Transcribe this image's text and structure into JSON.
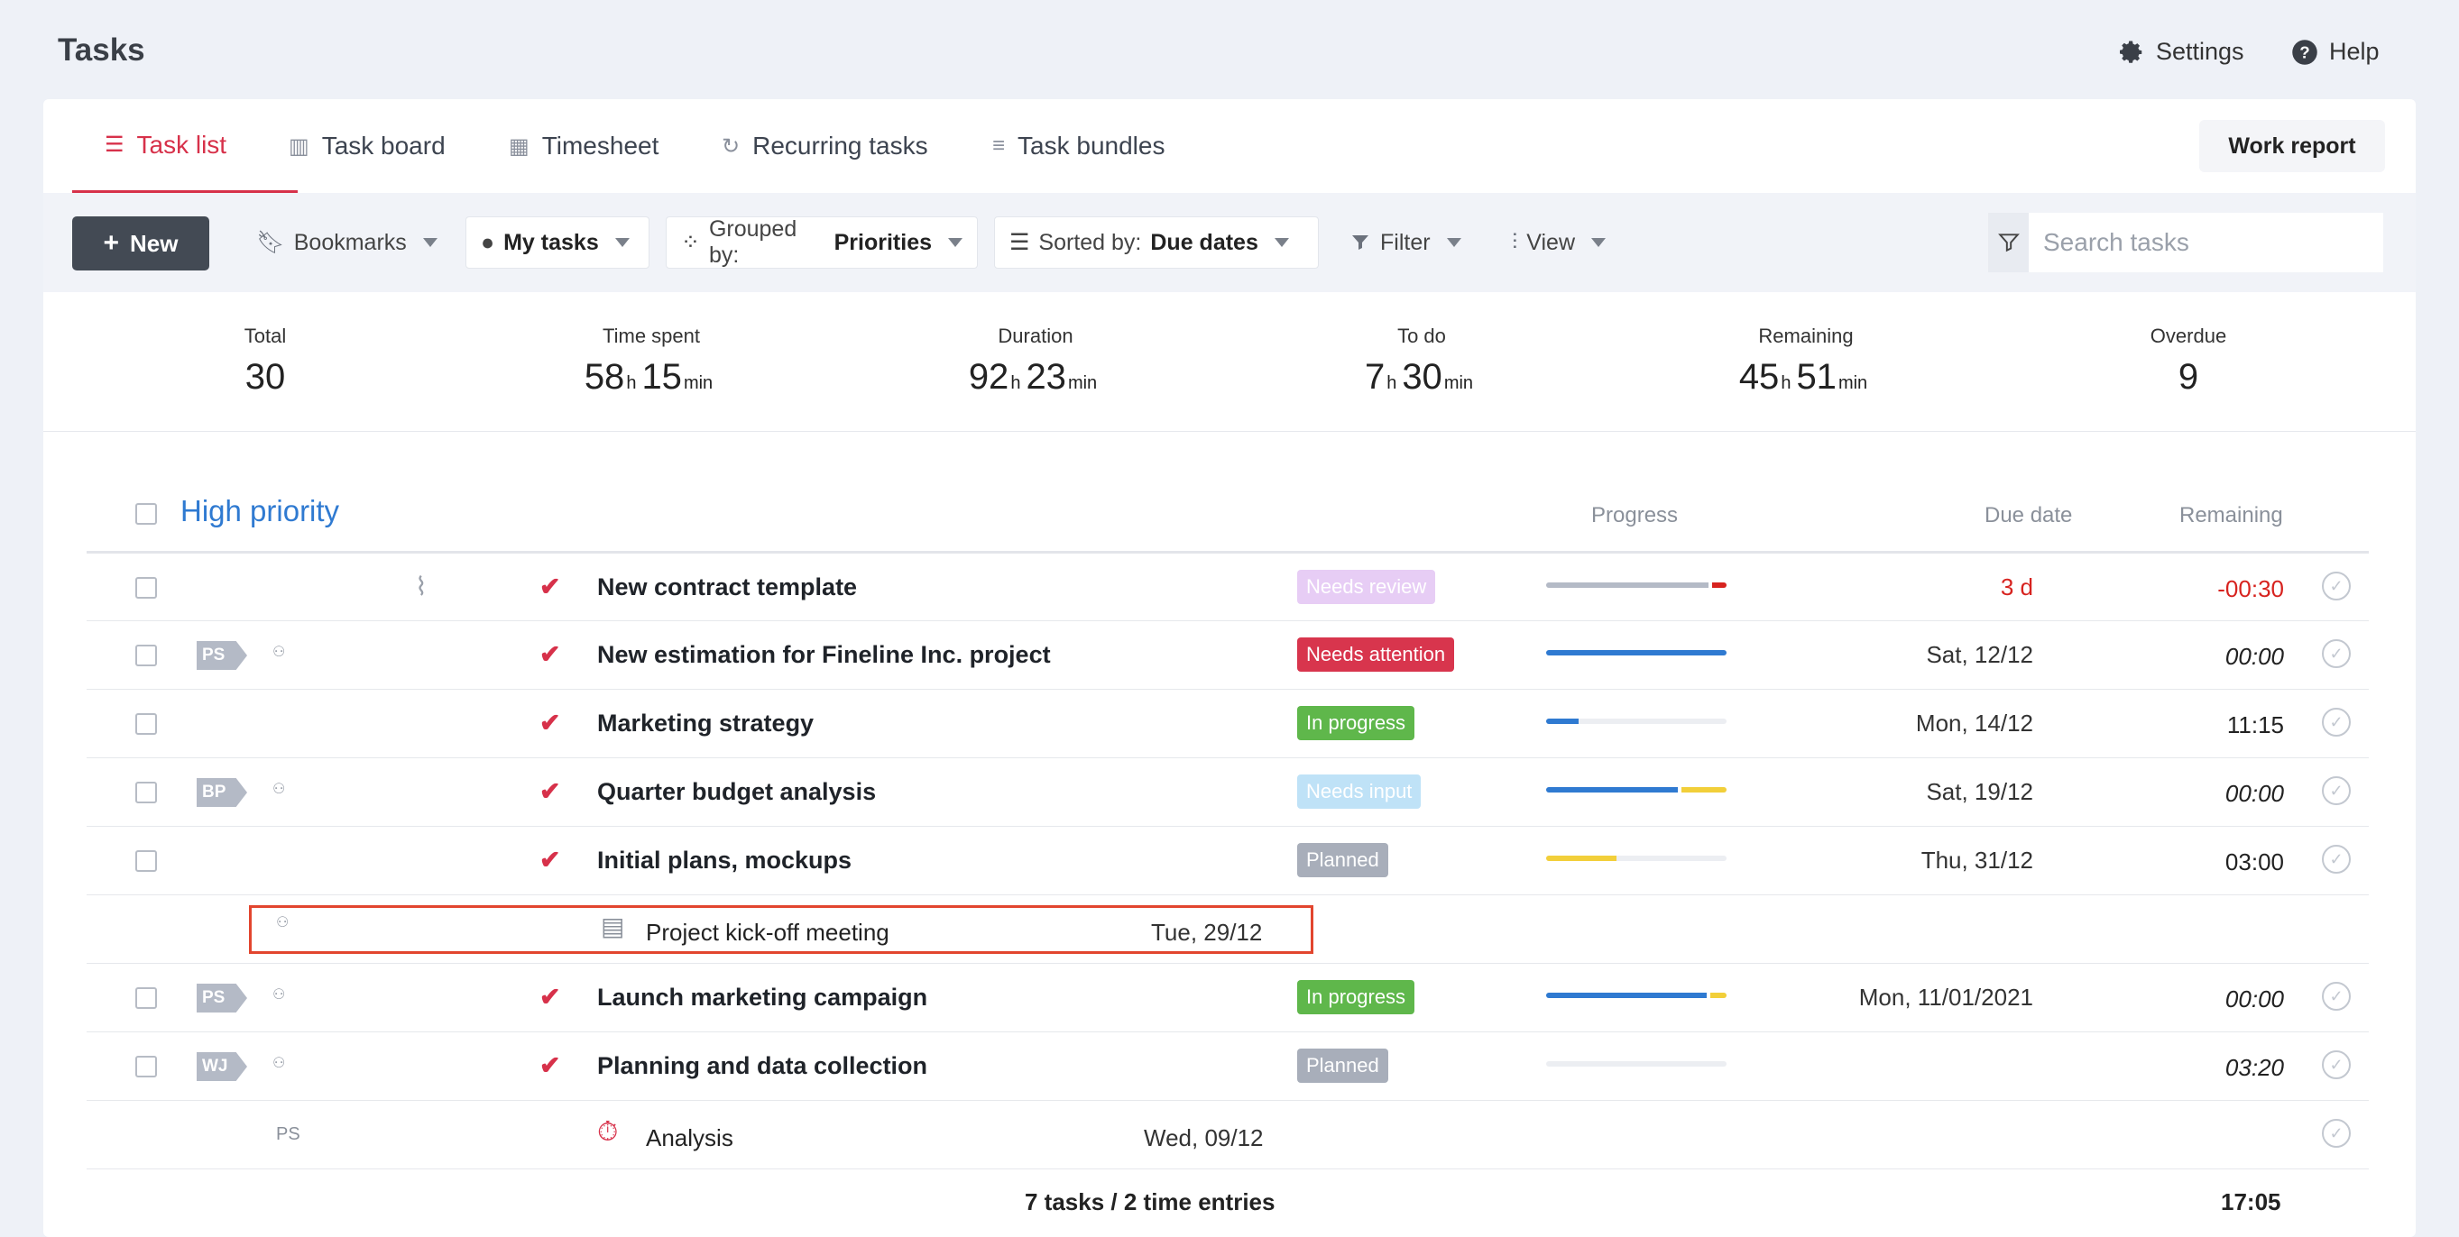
{
  "page": {
    "title": "Tasks"
  },
  "header": {
    "settings": "Settings",
    "help": "Help"
  },
  "tabs": [
    {
      "label": "Task list",
      "icon": "list-icon",
      "active": true
    },
    {
      "label": "Task board",
      "icon": "board-icon"
    },
    {
      "label": "Timesheet",
      "icon": "timesheet-icon"
    },
    {
      "label": "Recurring tasks",
      "icon": "recurring-icon"
    },
    {
      "label": "Task bundles",
      "icon": "bundles-icon"
    }
  ],
  "work_report": "Work report",
  "toolbar": {
    "new": "New",
    "bookmarks": "Bookmarks",
    "my_tasks": "My tasks",
    "grouped_prefix": "Grouped by:",
    "grouped_value": "Priorities",
    "sorted_prefix": "Sorted by:",
    "sorted_value": "Due dates",
    "filter": "Filter",
    "view": "View",
    "search_placeholder": "Search tasks"
  },
  "stats": [
    {
      "label": "Total",
      "value": "30"
    },
    {
      "label": "Time spent",
      "h": "58",
      "m": "15"
    },
    {
      "label": "Duration",
      "h": "92",
      "m": "23"
    },
    {
      "label": "To do",
      "h": "7",
      "m": "30"
    },
    {
      "label": "Remaining",
      "h": "45",
      "m": "51"
    },
    {
      "label": "Overdue",
      "value": "9"
    }
  ],
  "units": {
    "h": "h",
    "min": "min"
  },
  "group": {
    "title": "High priority",
    "col_progress": "Progress",
    "col_due": "Due date",
    "col_remaining": "Remaining"
  },
  "rows": [
    {
      "name": "New contract template",
      "status": "Needs review",
      "due": "3 d",
      "remaining": "-00:30"
    },
    {
      "initials": "PS",
      "name": "New estimation for Fineline Inc. project",
      "status": "Needs attention",
      "due": "Sat, 12/12",
      "remaining": "00:00"
    },
    {
      "name": "Marketing strategy",
      "status": "In progress",
      "due": "Mon, 14/12",
      "remaining": "11:15"
    },
    {
      "initials": "BP",
      "name": "Quarter budget analysis",
      "status": "Needs input",
      "due": "Sat, 19/12",
      "remaining": "00:00"
    },
    {
      "name": "Initial plans, mockups",
      "status": "Planned",
      "due": "Thu, 31/12",
      "remaining": "03:00"
    },
    {
      "name": "Project kick-off meeting",
      "date": "Tue, 29/12"
    },
    {
      "initials": "PS",
      "name": "Launch marketing campaign",
      "status": "In progress",
      "due": "Mon, 11/01/2021",
      "remaining": "00:00"
    },
    {
      "initials": "WJ",
      "name": "Planning and data collection",
      "status": "Planned",
      "remaining": "03:20"
    },
    {
      "initials": "PS",
      "name": "Analysis",
      "date": "Wed, 09/12"
    }
  ],
  "footer": {
    "summary": "7 tasks / 2 time entries",
    "total": "17:05"
  },
  "colors": {
    "accent": "#d7314a",
    "blue": "#2f7ad1",
    "green": "#5fb74b",
    "yellow": "#f2cf3a",
    "red_bar": "#d7231f",
    "gray_bar": "#b4bac6"
  }
}
